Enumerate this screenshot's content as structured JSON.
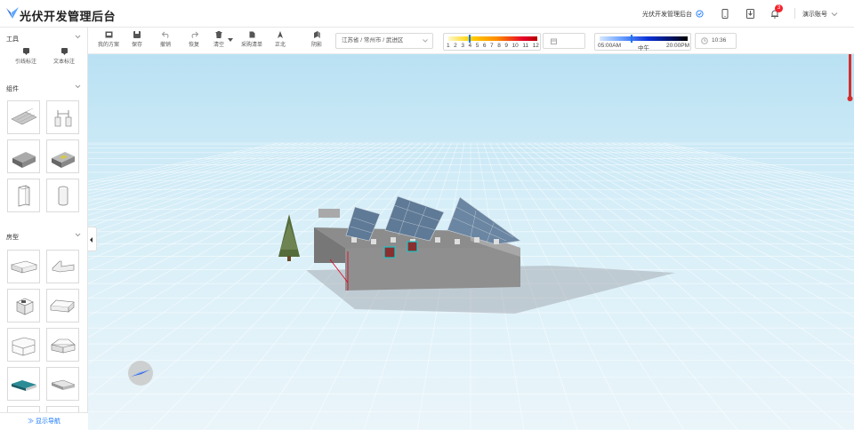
{
  "app": {
    "title": "光伏开发管理后台"
  },
  "header": {
    "platform_link": "光伏开发管理后台",
    "notification_count": "3",
    "user_name": "演示账号"
  },
  "sidebar": {
    "sections": {
      "tools": "工具",
      "components": "组件",
      "roof_types": "房型"
    },
    "tools": [
      {
        "label": "引线标注",
        "icon": "leader-label-icon"
      },
      {
        "label": "文本标注",
        "icon": "text-label-icon"
      }
    ],
    "nav_toggle": "≫ 显示导航"
  },
  "toolbar": {
    "buttons": [
      "我的方案",
      "保存",
      "撤销",
      "恢复",
      "清空",
      "采购清单",
      "正北",
      "阴影"
    ],
    "location": "江苏省 / 常州市 / 武进区",
    "month_ticks": [
      "1",
      "2",
      "3",
      "4",
      "5",
      "6",
      "7",
      "8",
      "9",
      "10",
      "11",
      "12"
    ],
    "time_labels": [
      "05:00AM",
      "中午",
      "20:00PM"
    ],
    "time_value": "10:36"
  },
  "colors": {
    "accent": "#1677ff",
    "badge": "#f5222d"
  }
}
